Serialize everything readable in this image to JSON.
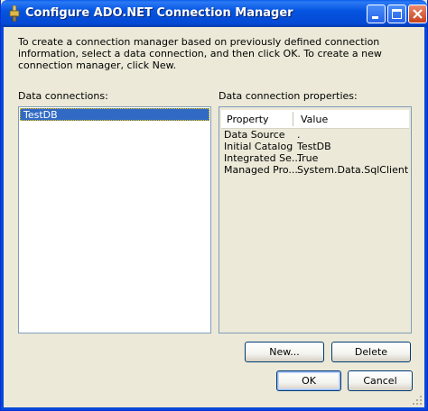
{
  "window": {
    "title": "Configure ADO.NET Connection Manager"
  },
  "intro_text": "To create a connection manager based on previously defined connection information, select a data connection, and then click OK. To create a new connection manager, click New.",
  "connections": {
    "label": "Data connections:",
    "items": [
      "TestDB"
    ],
    "selected_index": 0
  },
  "properties": {
    "label": "Data connection properties:",
    "columns": {
      "property": "Property",
      "value": "Value"
    },
    "rows": [
      {
        "property": "Data Source",
        "value": "."
      },
      {
        "property": "Initial Catalog",
        "value": "TestDB"
      },
      {
        "property": "Integrated Se...",
        "value": "True"
      },
      {
        "property": "Managed Pro...",
        "value": "System.Data.SqlClient"
      }
    ]
  },
  "buttons": {
    "new": "New...",
    "delete": "Delete",
    "ok": "OK",
    "cancel": "Cancel"
  }
}
